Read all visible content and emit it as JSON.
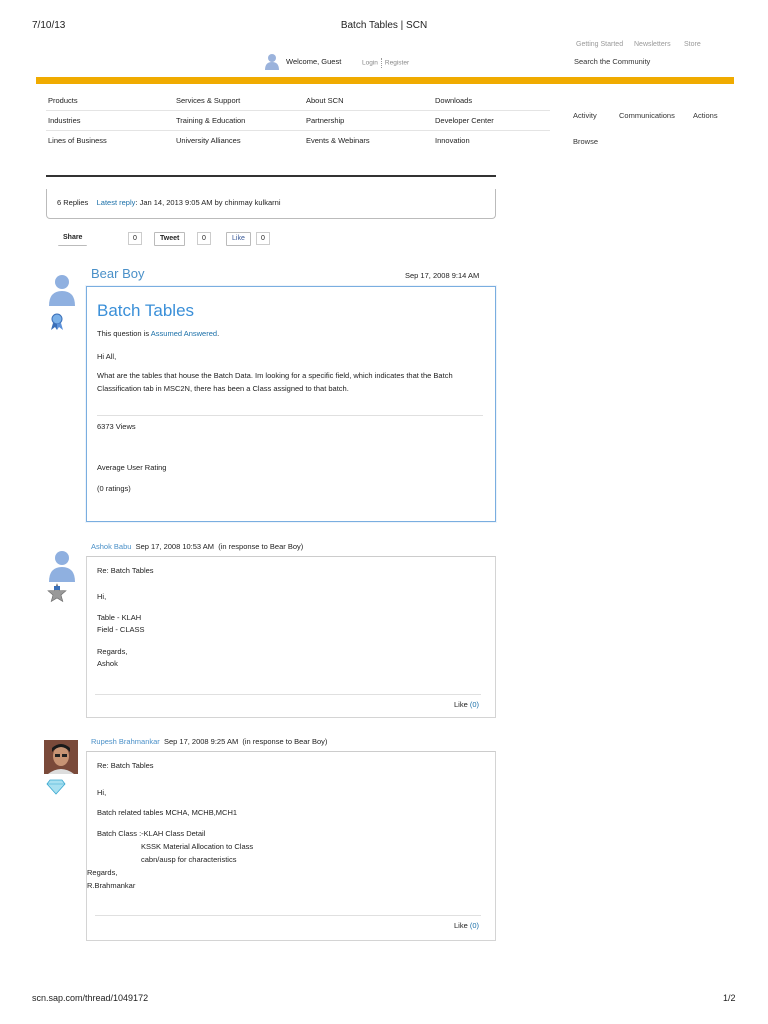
{
  "header": {
    "date": "7/10/13",
    "title": "Batch Tables | SCN",
    "util_links": [
      "Getting Started",
      "Newsletters",
      "Store"
    ],
    "search_label": "Search the Community",
    "welcome": "Welcome, Guest",
    "login": "Login",
    "register": "Register"
  },
  "nav": {
    "col1": [
      "Products",
      "Industries",
      "Lines of Business"
    ],
    "col2": [
      "Services & Support",
      "Training & Education",
      "University Alliances"
    ],
    "col3": [
      "About SCN",
      "Partnership",
      "Events & Webinars"
    ],
    "col4": [
      "Downloads",
      "Developer Center",
      "Innovation"
    ],
    "side": [
      "Activity",
      "Communications",
      "Actions",
      "Browse"
    ]
  },
  "thread_info": {
    "replies": "6 Replies",
    "latest_reply_label": "Latest reply",
    "latest_reply_text": ": Jan 14, 2013 9:05 AM by chinmay kulkarni"
  },
  "share": {
    "share_label": "Share",
    "share_count": "0",
    "tweet_label": "Tweet",
    "tweet_count": "0",
    "like_label": "Like",
    "like_count": "0"
  },
  "question": {
    "author": "Bear Boy",
    "date": "Sep 17, 2008 9:14 AM",
    "title": "Batch Tables",
    "status_prefix": "This question is",
    "status_link": "Assumed Answered",
    "status_suffix": ".",
    "greeting": "Hi All,",
    "body": "What are the tables that house the Batch Data. Im looking for a specific field, which indicates that the Batch Classification tab in MSC2N, there has been a Class assigned to that batch.",
    "views": "6373 Views",
    "rating_label": "Average User Rating",
    "ratings": "(0 ratings)"
  },
  "replies": [
    {
      "author": "Ashok Babu",
      "date": "Sep 17, 2008 10:53 AM",
      "response_to": "(in response to Bear Boy)",
      "subject": "Re: Batch Tables",
      "lines": [
        "Hi,",
        "Table - KLAH",
        "Field - CLASS",
        "Regards,",
        "Ashok"
      ],
      "like_label": "Like",
      "like_count": "(0)"
    },
    {
      "author": "Rupesh Brahmankar",
      "date": "Sep 17, 2008 9:25 AM",
      "response_to": "(in response to Bear Boy)",
      "subject": "Re: Batch Tables",
      "lines": [
        "Hi,",
        "Batch related tables MCHA, MCHB,MCH1",
        "Batch Class :-KLAH Class Detail",
        "KSSK Material Allocation to Class",
        "cabn/ausp for characteristics",
        "Regards,",
        "R.Brahmankar"
      ],
      "like_label": "Like",
      "like_count": "(0)"
    }
  ],
  "footer": {
    "url": "scn.sap.com/thread/1049172",
    "page": "1/2"
  }
}
